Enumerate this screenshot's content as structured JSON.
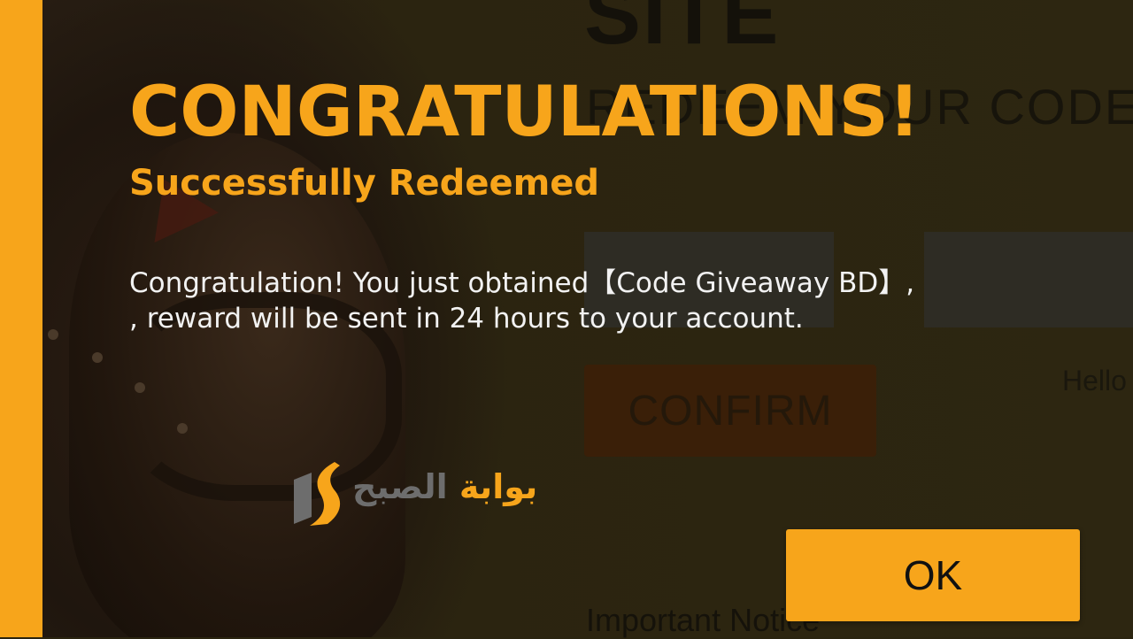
{
  "background": {
    "site_heading": "SITE",
    "redeem_heading": "REDEEM YOUR CODE",
    "confirm_label": "CONFIRM",
    "hello_text": "Hello",
    "notice_heading": "Important Notice"
  },
  "dialog": {
    "headline": "CONGRATULATIONS!",
    "subheadline": "Successfully Redeemed",
    "message_line_1": "Congratulation! You just obtained【Code Giveaway BD】,",
    "message_line_2": ", reward will be sent in 24 hours to your account.",
    "ok_label": "OK"
  },
  "watermark": {
    "text_orange": "بوابة",
    "text_gray": "الصبح"
  },
  "colors": {
    "accent": "#f7a51b",
    "background": "#2a2410",
    "message_text": "#f2f2f2",
    "confirm_bg": "#3a1f08"
  }
}
